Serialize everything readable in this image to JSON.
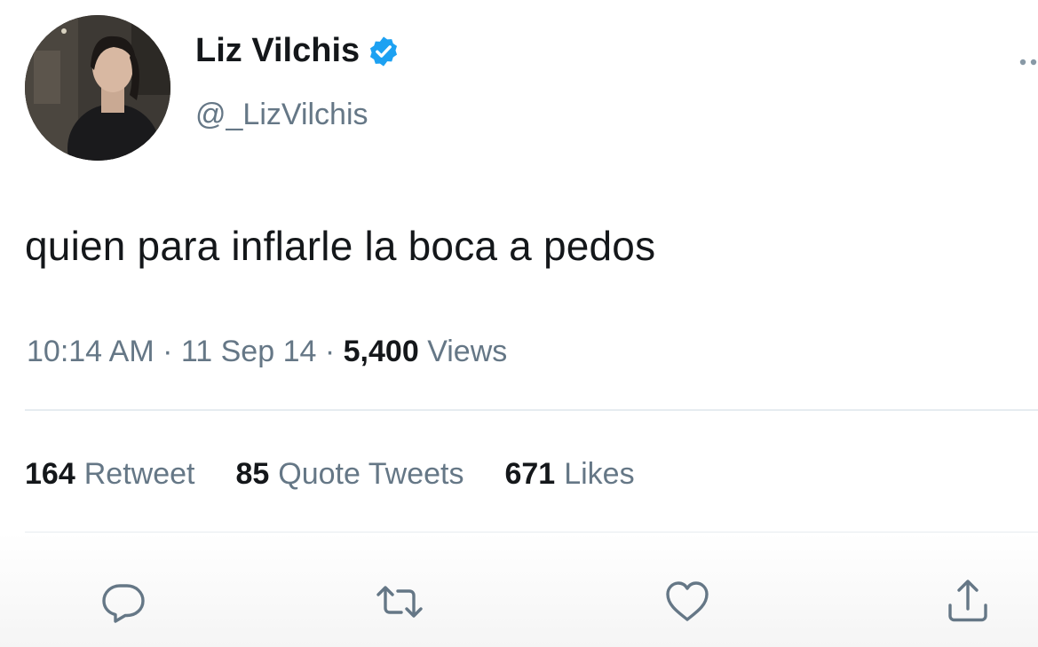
{
  "author": {
    "name": "Liz Vilchis",
    "handle": "@_LizVilchis",
    "verified": true
  },
  "tweet": {
    "text": "quien para inflarle la boca a pedos",
    "time": "10:14 AM",
    "separator": "·",
    "date": "11 Sep 14",
    "views_count": "5,400",
    "views_label": "Views"
  },
  "stats": {
    "retweets_count": "164",
    "retweets_label": "Retweet",
    "quotes_count": "85",
    "quotes_label": "Quote Tweets",
    "likes_count": "671",
    "likes_label": "Likes"
  },
  "actions": [
    {
      "icon": "reply-icon"
    },
    {
      "icon": "retweet-icon"
    },
    {
      "icon": "like-icon"
    },
    {
      "icon": "share-icon"
    }
  ],
  "colors": {
    "text": "#14171a",
    "secondary": "#657786",
    "verified": "#1da1f2",
    "divider": "#e6ecf0",
    "icon": "#657786"
  }
}
